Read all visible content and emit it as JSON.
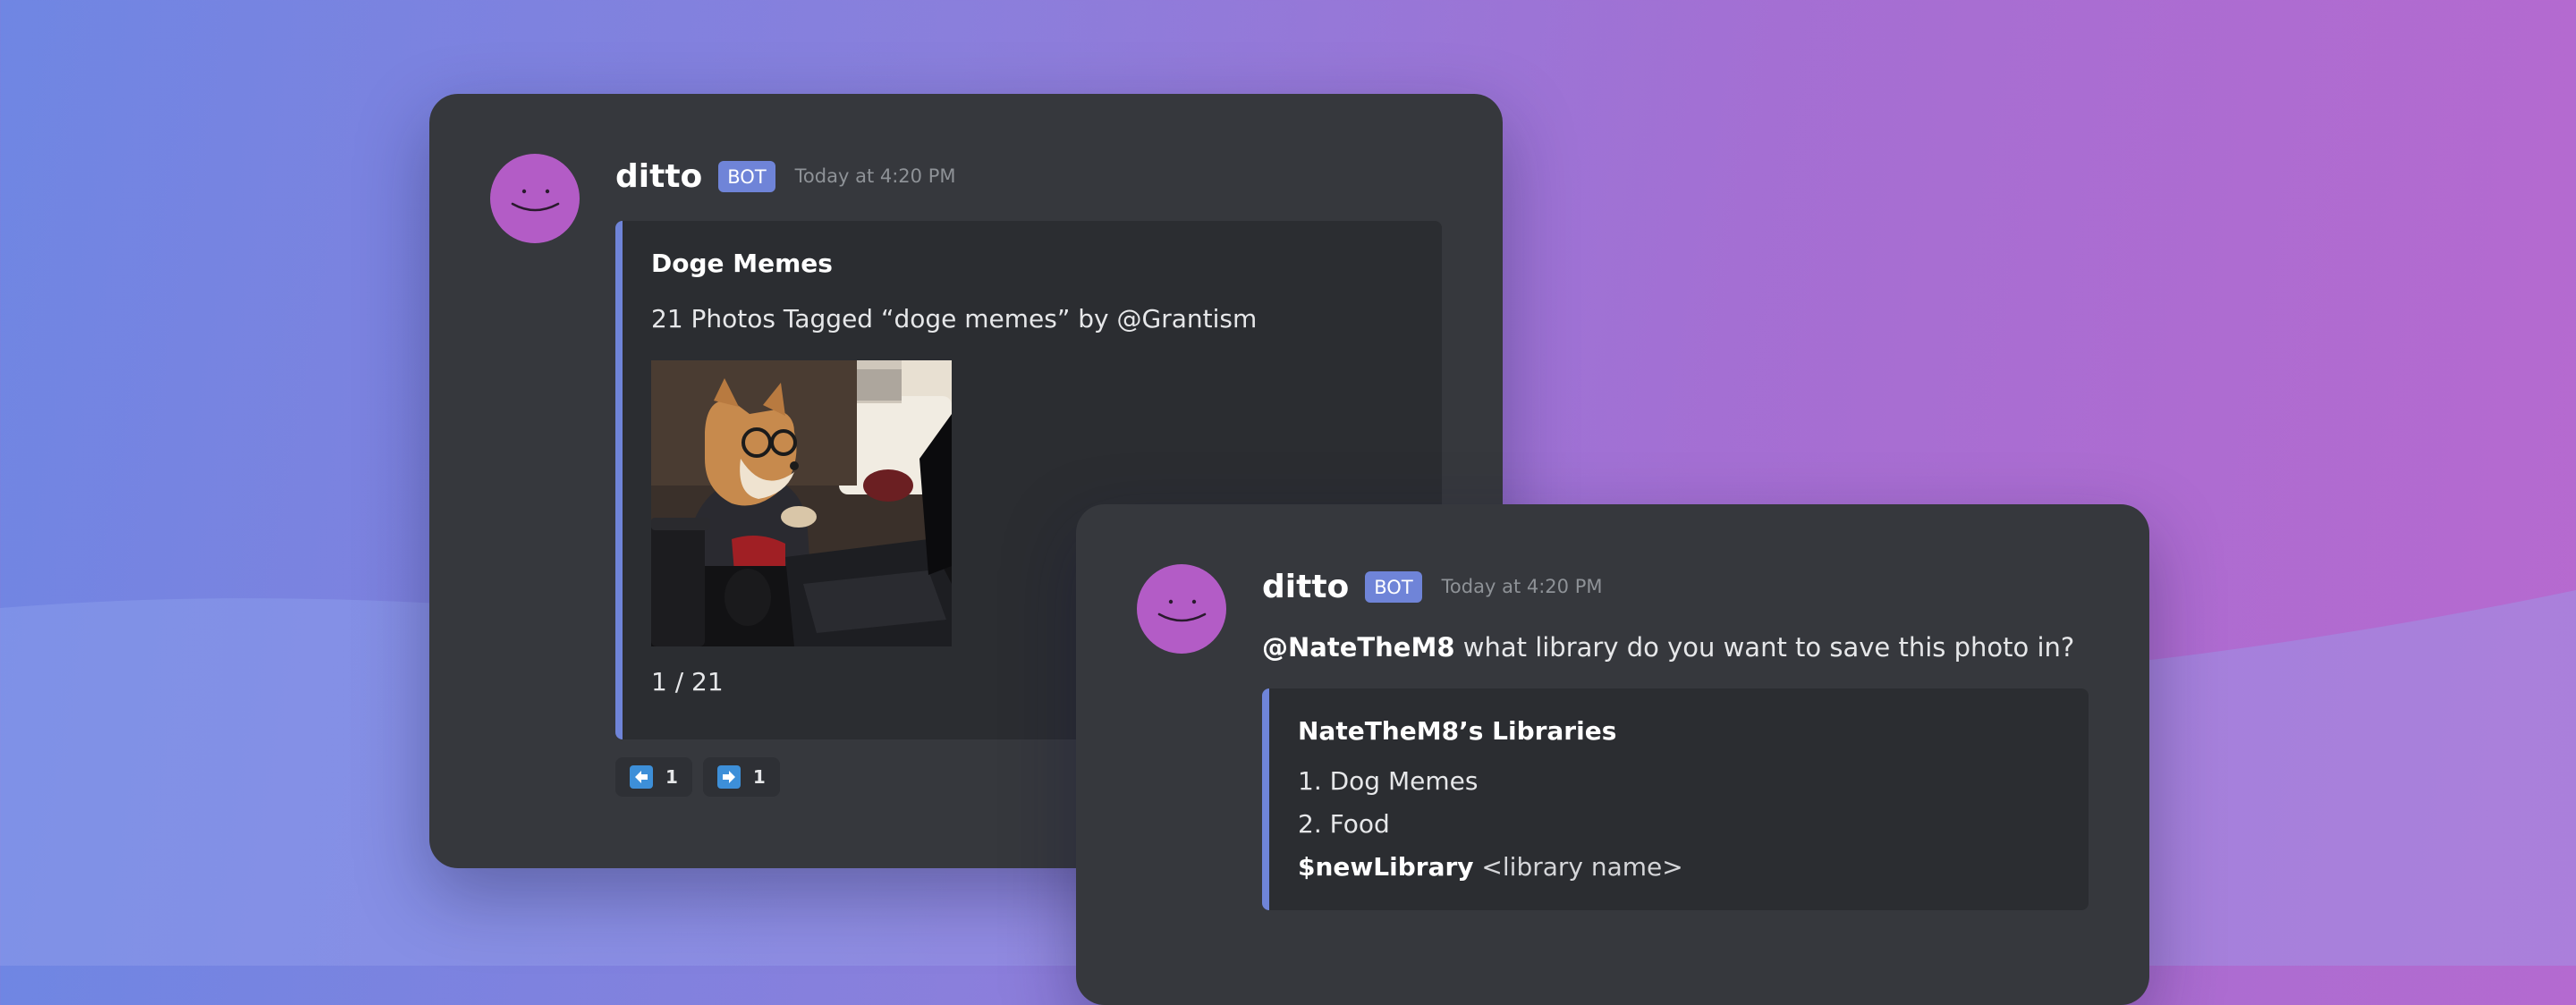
{
  "colors": {
    "card_background": "#36383d",
    "embed_background": "#2b2d31",
    "embed_accent": "#6f84d8",
    "avatar": "#b35cc6",
    "bot_badge": "#6f84d8",
    "timestamp": "#8e9297"
  },
  "message1": {
    "avatar_icon": "ditto-face-icon",
    "username": "ditto",
    "badge": "BOT",
    "timestamp": "Today at 4:20 PM",
    "embed": {
      "title": "Doge Memes",
      "description": "21 Photos Tagged “doge memes” by @Grantism",
      "image": "doge-at-laptop-photo",
      "footer": "1 / 21"
    },
    "reactions": [
      {
        "icon": "arrow-left-icon",
        "count": "1"
      },
      {
        "icon": "arrow-right-icon",
        "count": "1"
      }
    ]
  },
  "message2": {
    "avatar_icon": "ditto-face-icon",
    "username": "ditto",
    "badge": "BOT",
    "timestamp": "Today at 4:20 PM",
    "mention": "@NateTheM8",
    "text": " what library do you want to save this photo in?",
    "embed": {
      "title": "NateTheM8’s Libraries",
      "items": [
        "1. Dog Memes",
        "2. Food"
      ],
      "command": "$newLibrary",
      "command_arg": " <library name>"
    }
  }
}
